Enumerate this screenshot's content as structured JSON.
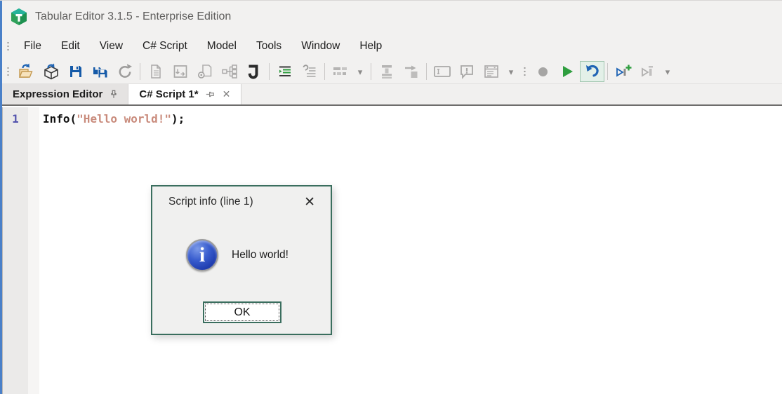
{
  "window": {
    "title": "Tabular Editor 3.1.5 - Enterprise Edition"
  },
  "colors": {
    "accent_edge_blue": "#4a80c8",
    "chrome_bg": "#f2f1f0",
    "save_blue": "#155aa8",
    "play_green": "#2f9e3f",
    "undo_blue": "#1f64b4",
    "undo_highlight_bg": "#e3f0e8",
    "undo_highlight_border": "#a0c5af",
    "dialog_border_teal": "#3a6e5e",
    "string_literal": "#c98b7c",
    "line_number_purple": "#5353ad",
    "tab_inactive_bg": "#e5e3e2",
    "tab_active_bg": "#ffffff"
  },
  "menubar": {
    "items": [
      {
        "label": "File"
      },
      {
        "label": "Edit"
      },
      {
        "label": "View"
      },
      {
        "label": "C# Script"
      },
      {
        "label": "Model"
      },
      {
        "label": "Tools"
      },
      {
        "label": "Window"
      },
      {
        "label": "Help"
      }
    ]
  },
  "toolbar": {
    "buttons": [
      "open-file",
      "open-model",
      "save",
      "save-all",
      "refresh",
      "new-document",
      "window-preferences",
      "document-link",
      "hierarchy",
      "new-csharp-script",
      "format-indent",
      "format-reindent",
      "layout-blocks",
      "layout-dropdown",
      "column-width",
      "goto-box",
      "textbox",
      "comment-warning",
      "window-list",
      "window-list-dropdown",
      "record",
      "play",
      "undo",
      "run-script-new",
      "run-script",
      "run-script-dropdown"
    ]
  },
  "icons": {
    "dropdown": "▾",
    "close": "✕",
    "info_letter": "i"
  },
  "tabs": [
    {
      "label": "Expression Editor",
      "active": false,
      "pinned": true
    },
    {
      "label": "C# Script 1*",
      "active": true,
      "pinned": false
    }
  ],
  "editor": {
    "line_number": "1",
    "code": {
      "function_part": "Info(",
      "string_part": "\"Hello world!\"",
      "close_part": ");"
    }
  },
  "dialog": {
    "title": "Script info (line 1)",
    "message": "Hello world!",
    "ok_label": "OK"
  }
}
